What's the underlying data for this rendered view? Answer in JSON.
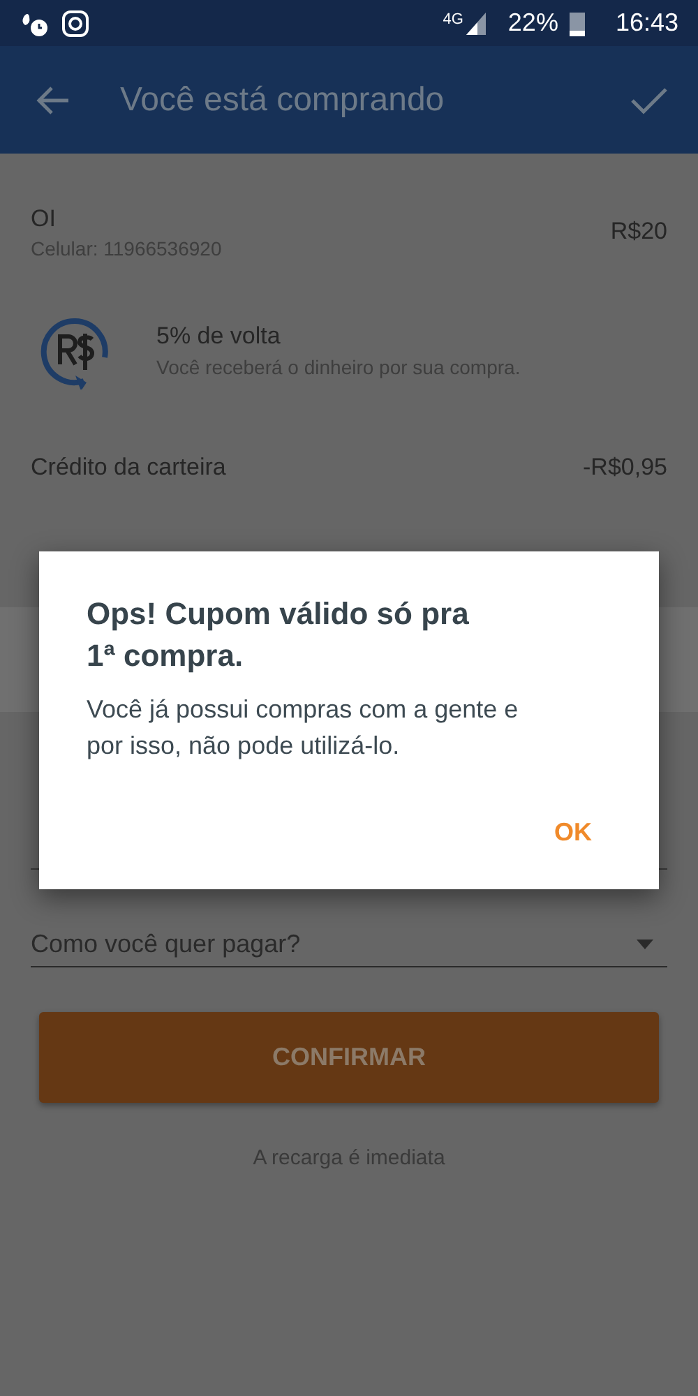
{
  "status_bar": {
    "network": "4G",
    "battery": "22%",
    "time": "16:43"
  },
  "app_bar": {
    "title": "Você está comprando"
  },
  "product": {
    "name": "OI",
    "phone": "Celular: 11966536920",
    "price": "R$20"
  },
  "cashback": {
    "title": "5% de volta",
    "description": "Você receberá o dinheiro por sua compra."
  },
  "wallet_credit": {
    "label": "Crédito da carteira",
    "amount": "-R$0,95"
  },
  "payment_select": {
    "placeholder": "Como você quer pagar?"
  },
  "confirm_button": {
    "label": "CONFIRMAR"
  },
  "footnote": "A recarga é imediata",
  "dialog": {
    "title": "Ops! Cupom válido só pra 1ª compra.",
    "message": "Você já possui compras com a gente e por isso, não pode utilizá-lo.",
    "button": "OK"
  }
}
